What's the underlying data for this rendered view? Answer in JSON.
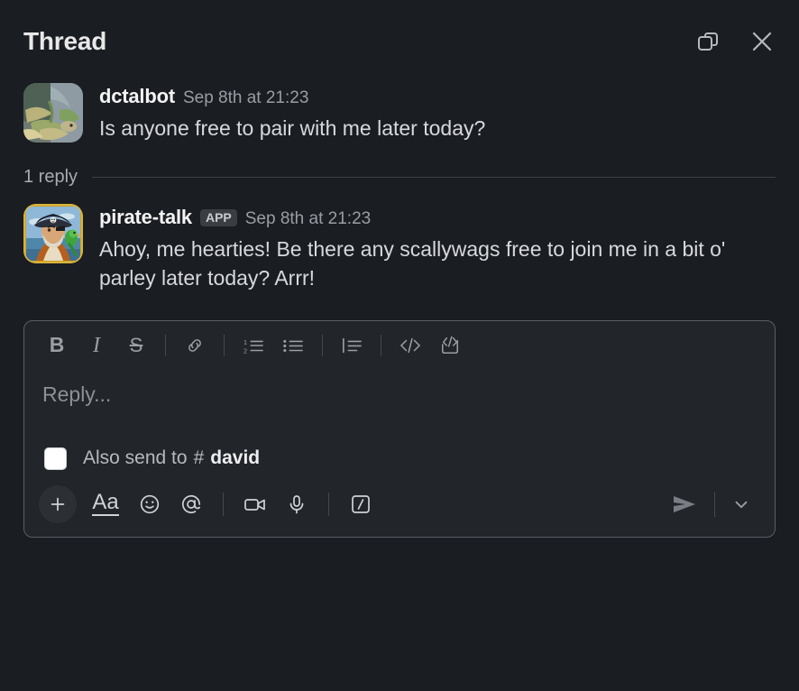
{
  "header": {
    "title": "Thread",
    "open_window_icon": "open-in-new-window-icon",
    "close_icon": "close-icon"
  },
  "messages": [
    {
      "author": "dctalbot",
      "badge": null,
      "timestamp": "Sep 8th at 21:23",
      "text": "Is anyone free to pair with me later today?",
      "avatar_icon": "iguana-photo-avatar"
    },
    {
      "author": "pirate-talk",
      "badge": "APP",
      "timestamp": "Sep 8th at 21:23",
      "text": "Ahoy, me hearties! Be there any scallywags free to join me in a bit o' parley later today? Arrr!",
      "avatar_icon": "pirate-portrait-avatar"
    }
  ],
  "reply_divider": {
    "count_label": "1 reply"
  },
  "composer": {
    "placeholder": "Reply...",
    "format_buttons": [
      {
        "name": "bold-icon",
        "label": "B"
      },
      {
        "name": "italic-icon",
        "label": "I"
      },
      {
        "name": "strikethrough-icon",
        "label": "S"
      },
      {
        "name": "link-icon",
        "label": ""
      },
      {
        "name": "ordered-list-icon",
        "label": ""
      },
      {
        "name": "bulleted-list-icon",
        "label": ""
      },
      {
        "name": "blockquote-icon",
        "label": ""
      },
      {
        "name": "code-icon",
        "label": ""
      },
      {
        "name": "code-block-icon",
        "label": ""
      }
    ],
    "also_send": {
      "checked": false,
      "label": "Also send to",
      "hash": "#",
      "channel": "david"
    },
    "actions": [
      {
        "name": "add-attachment-button",
        "label": "+"
      },
      {
        "name": "formatting-button",
        "label": "Aa"
      },
      {
        "name": "emoji-button",
        "label": ""
      },
      {
        "name": "mention-button",
        "label": "@"
      },
      {
        "name": "video-button",
        "label": ""
      },
      {
        "name": "audio-button",
        "label": ""
      },
      {
        "name": "slash-command-button",
        "label": ""
      }
    ],
    "send_icon": "send-icon",
    "send_options_icon": "chevron-down-icon"
  },
  "colors": {
    "background": "#1a1d21",
    "composer_bg": "#222529",
    "text_primary": "#d7d9dc",
    "text_muted": "#9a9ea4",
    "border": "#5a5d63",
    "badge_bg": "#3a3d42"
  }
}
